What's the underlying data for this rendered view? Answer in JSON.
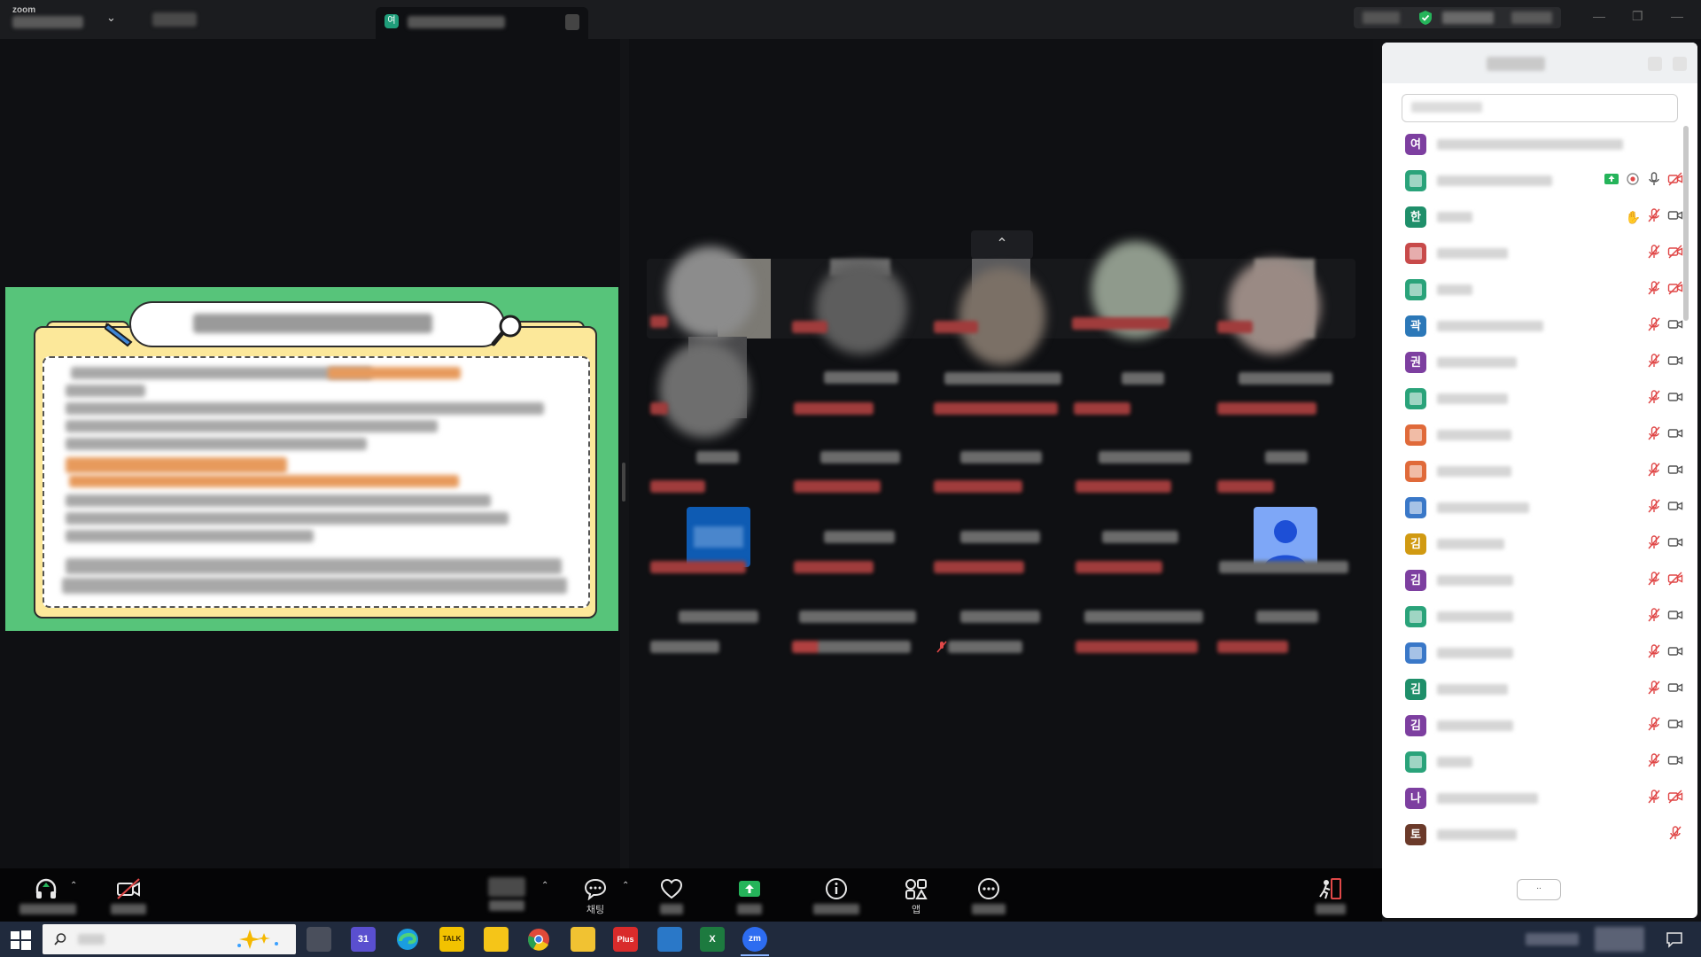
{
  "titlebar": {
    "app_logo": "zoom",
    "meeting_tab_avatar": "여",
    "window_controls": [
      "—",
      "❐",
      "—"
    ]
  },
  "toolbar": {
    "chat_label": "채팅",
    "apps_label": "앱"
  },
  "participants": {
    "footer_button": "..",
    "rows": [
      {
        "avatar": "여",
        "color": "#7d3fa0",
        "name_w": 210,
        "icons": []
      },
      {
        "avatar": "",
        "color": "#2aa37a",
        "name_w": 130,
        "icons": [
          "share-icon",
          "record-icon",
          "mic-on-icon",
          "video-off-icon"
        ]
      },
      {
        "avatar": "한",
        "color": "#1f8f6a",
        "name_w": 40,
        "icons": [
          "raise-hand-icon",
          "mic-muted-icon",
          "video-on-icon"
        ]
      },
      {
        "avatar": "",
        "color": "#c84a4a",
        "name_w": 80,
        "icons": [
          "mic-muted-icon",
          "video-off-icon"
        ]
      },
      {
        "avatar": "",
        "color": "#2aa37a",
        "name_w": 40,
        "icons": [
          "mic-muted-icon",
          "video-off-icon"
        ]
      },
      {
        "avatar": "곽",
        "color": "#2c78b8",
        "name_w": 120,
        "icons": [
          "mic-muted-icon",
          "video-on-icon"
        ]
      },
      {
        "avatar": "권",
        "color": "#7d3fa0",
        "name_w": 90,
        "icons": [
          "mic-muted-icon",
          "video-on-icon"
        ]
      },
      {
        "avatar": "",
        "color": "#2aa37a",
        "name_w": 80,
        "icons": [
          "mic-muted-icon",
          "video-on-icon"
        ]
      },
      {
        "avatar": "",
        "color": "#e06a3a",
        "name_w": 84,
        "icons": [
          "mic-muted-icon",
          "video-on-icon"
        ]
      },
      {
        "avatar": "",
        "color": "#e06a3a",
        "name_w": 84,
        "icons": [
          "mic-muted-icon",
          "video-on-icon"
        ]
      },
      {
        "avatar": "",
        "color": "#3a78c8",
        "name_w": 104,
        "icons": [
          "mic-muted-icon",
          "video-on-icon"
        ]
      },
      {
        "avatar": "김",
        "color": "#d19a12",
        "name_w": 76,
        "icons": [
          "mic-muted-icon",
          "video-on-icon"
        ]
      },
      {
        "avatar": "김",
        "color": "#7d3fa0",
        "name_w": 86,
        "icons": [
          "mic-muted-icon",
          "video-off-icon"
        ]
      },
      {
        "avatar": "",
        "color": "#2aa37a",
        "name_w": 86,
        "icons": [
          "mic-muted-icon",
          "video-on-icon"
        ]
      },
      {
        "avatar": "",
        "color": "#3a78c8",
        "name_w": 86,
        "icons": [
          "mic-muted-icon",
          "video-on-icon"
        ]
      },
      {
        "avatar": "김",
        "color": "#1f8f6a",
        "name_w": 80,
        "icons": [
          "mic-muted-icon",
          "video-on-icon"
        ]
      },
      {
        "avatar": "김",
        "color": "#7d3fa0",
        "name_w": 86,
        "icons": [
          "mic-muted-icon",
          "video-on-icon"
        ]
      },
      {
        "avatar": "",
        "color": "#2aa37a",
        "name_w": 40,
        "icons": [
          "mic-muted-icon",
          "video-on-icon"
        ]
      },
      {
        "avatar": "나",
        "color": "#7d3fa0",
        "name_w": 114,
        "icons": [
          "mic-muted-icon",
          "video-off-icon"
        ]
      },
      {
        "avatar": "토",
        "color": "#6b3a2a",
        "name_w": 90,
        "icons": [
          "mic-muted-icon"
        ]
      }
    ]
  },
  "taskbar": {
    "apps": [
      {
        "name": "calendar-app",
        "label": "31",
        "color": "#5a4fcf"
      },
      {
        "name": "kakaotalk-app",
        "label": "TALK",
        "color": "#f2c200"
      },
      {
        "name": "plus-app",
        "label": "Plus",
        "color": "#d92b2b"
      },
      {
        "name": "excel-app",
        "label": "X",
        "color": "#1d7a3f"
      },
      {
        "name": "zoom-app",
        "label": "zm",
        "color": "#2d6cf0"
      }
    ]
  }
}
